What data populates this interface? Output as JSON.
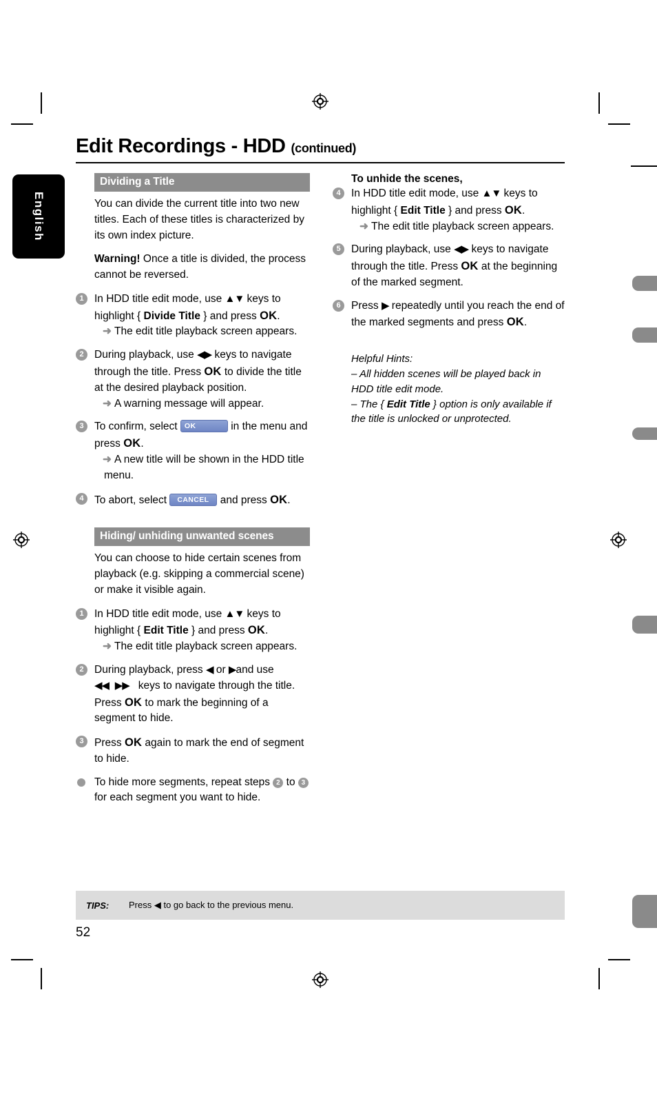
{
  "language_tab": {
    "label": "English"
  },
  "header": {
    "title": "Edit Recordings - HDD",
    "continued": "(continued)"
  },
  "left_column": {
    "section1": {
      "heading": "Dividing a Title",
      "intro": "You can divide the current title into two new titles. Each of these titles is characterized by its own index picture.",
      "warning_label": "Warning!",
      "warning_text": " Once a title is divided, the process cannot be reversed.",
      "steps": [
        {
          "num": "1",
          "text_1": "In HDD title edit mode, use ",
          "keys": "▲▼",
          "text_2": " keys to highlight { ",
          "bold_1": "Divide Title",
          "text_3": " } and press ",
          "bold_2": "OK",
          "text_4": ".",
          "result": "The edit title playback screen appears."
        },
        {
          "num": "2",
          "text_1": "During playback, use ",
          "keys": "◀▶",
          "text_2": " keys to navigate through the title. Press ",
          "bold_1": "OK",
          "text_3": " to divide the title at the desired playback position.",
          "result": "A warning message will appear."
        },
        {
          "num": "3",
          "text_1": "To confirm, select ",
          "button": "OK",
          "text_2": " in the menu and press ",
          "bold_1": "OK",
          "text_3": ".",
          "result": "A new title will be shown in the HDD title menu."
        },
        {
          "num": "4",
          "text_1": "To abort, select ",
          "button": "CANCEL",
          "text_2": " and press ",
          "bold_1": "OK",
          "text_3": "."
        }
      ]
    },
    "section2": {
      "heading": "Hiding/ unhiding unwanted scenes",
      "intro": "You can choose to hide certain scenes from playback (e.g. skipping a commercial scene) or make it visible again.",
      "steps": [
        {
          "num": "1",
          "text_1": "In HDD title edit mode, use ",
          "keys": "▲▼",
          "text_2": " keys to highlight { ",
          "bold_1": "Edit Title",
          "text_3": " } and press ",
          "bold_2": "OK",
          "text_4": ".",
          "result": "The edit title playback screen appears."
        },
        {
          "num": "2",
          "text_1": "During playback, press ",
          "key_left": "◀",
          "text_2": " or ",
          "key_right": "▶",
          "text_3": "and use ",
          "keys_rew": "◀◀",
          "keys_ffw": "▶▶",
          "text_4": "keys to navigate through the title. Press ",
          "bold_1": "OK",
          "text_5": " to mark the beginning of a segment to hide."
        },
        {
          "num": "3",
          "text_1": "Press ",
          "bold_1": "OK",
          "text_2": " again to mark the end of segment to hide."
        }
      ],
      "bullet": {
        "text_1": "To hide more segments, repeat steps ",
        "ref_1": "2",
        "text_2": " to ",
        "ref_2": "3",
        "text_3": " for each segment you want to hide."
      }
    }
  },
  "right_column": {
    "sub_heading": "To unhide the scenes,",
    "steps": [
      {
        "num": "4",
        "text_1": "In HDD title edit mode, use ",
        "keys": "▲▼",
        "text_2": " keys to highlight { ",
        "bold_1": "Edit Title",
        "text_3": " } and press ",
        "bold_2": "OK",
        "text_4": ".",
        "result": "The edit title playback screen appears."
      },
      {
        "num": "5",
        "text_1": "During playback, use ",
        "keys": "◀▶",
        "text_2": " keys to navigate through the title. Press ",
        "bold_1": "OK",
        "text_3": " at the beginning of the marked segment."
      },
      {
        "num": "6",
        "text_1": "Press ",
        "keys": "▶",
        "text_2": " repeatedly until you reach the end of the marked segments and press ",
        "bold_1": "OK",
        "text_3": "."
      }
    ],
    "hints": {
      "title": "Helpful Hints:",
      "line1": "–  All hidden scenes will be played back in HDD title edit mode.",
      "line2_a": "–  The { ",
      "line2_bold": "Edit Title",
      "line2_b": " } option is only available if the title is unlocked or unprotected."
    }
  },
  "footer": {
    "tips_label": "TIPS:",
    "tips_text_1": "Press ",
    "tips_key": "◀",
    "tips_text_2": " to go back to the previous menu.",
    "page_number": "52"
  },
  "colors": {
    "section_band": "#8c8c8c",
    "step_number": "#9a9a9a",
    "osd_button": "#7f95ce",
    "tips_bar": "#dcdcdc",
    "language_tab": "#000000"
  }
}
